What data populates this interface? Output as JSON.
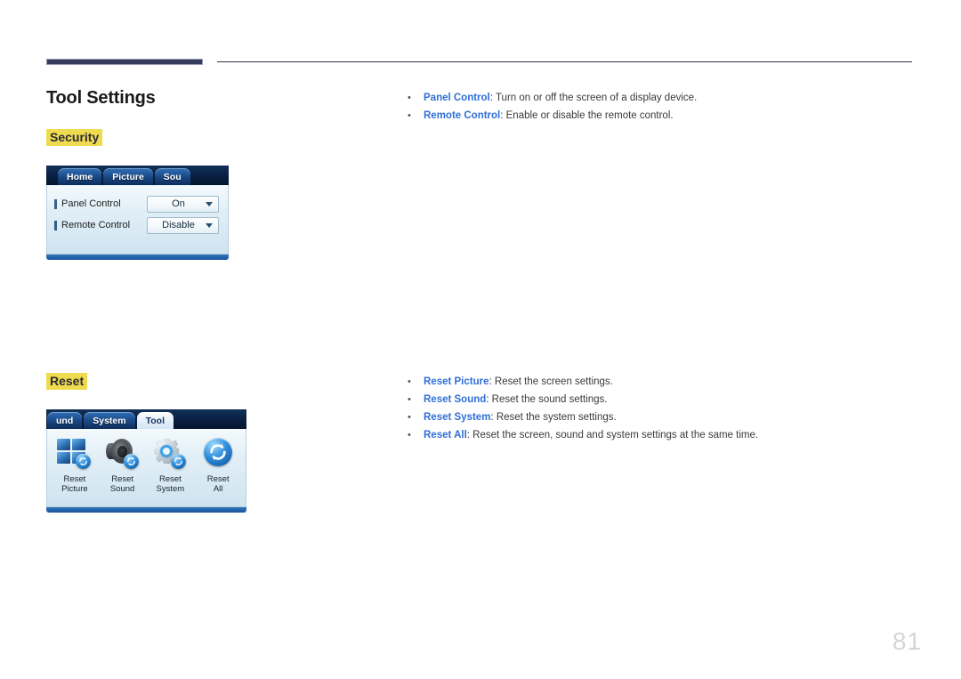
{
  "document": {
    "page_title": "Tool Settings",
    "page_number": "81"
  },
  "sections": [
    {
      "heading": "Security",
      "bullets": [
        {
          "dot": "•",
          "term": "Panel Control",
          "desc": ": Turn on or off the screen of a display device."
        },
        {
          "dot": "•",
          "term": "Remote Control",
          "desc": ": Enable or disable the remote control."
        }
      ]
    },
    {
      "heading": "Reset",
      "bullets": [
        {
          "dot": "•",
          "term": "Reset Picture",
          "desc": ": Reset the screen settings."
        },
        {
          "dot": "•",
          "term": "Reset Sound",
          "desc": ": Reset the sound settings."
        },
        {
          "dot": "•",
          "term": "Reset System",
          "desc": ": Reset the system settings."
        },
        {
          "dot": "•",
          "term": "Reset All",
          "desc": ": Reset the screen, sound and system settings at the same time."
        }
      ]
    }
  ],
  "osd_security": {
    "tabs": [
      {
        "label": "Home",
        "active": false
      },
      {
        "label": "Picture",
        "active": false
      },
      {
        "label": "Sou",
        "active": false
      }
    ],
    "rows": [
      {
        "label": "Panel Control",
        "value": "On"
      },
      {
        "label": "Remote Control",
        "value": "Disable"
      }
    ]
  },
  "osd_reset": {
    "tabs": [
      {
        "label": "und",
        "active": false
      },
      {
        "label": "System",
        "active": false
      },
      {
        "label": "Tool",
        "active": true
      }
    ],
    "items": [
      {
        "icon": "reset-picture-icon",
        "line1": "Reset",
        "line2": "Picture"
      },
      {
        "icon": "reset-sound-icon",
        "line1": "Reset",
        "line2": "Sound"
      },
      {
        "icon": "reset-system-icon",
        "line1": "Reset",
        "line2": "System"
      },
      {
        "icon": "reset-all-icon",
        "line1": "Reset",
        "line2": "All"
      }
    ]
  },
  "colors": {
    "rule_dark": "#343A5C",
    "highlight_yellow": "#EFDB4F",
    "term_blue": "#2F6FD8",
    "page_number_gray": "#D5D5D5"
  }
}
